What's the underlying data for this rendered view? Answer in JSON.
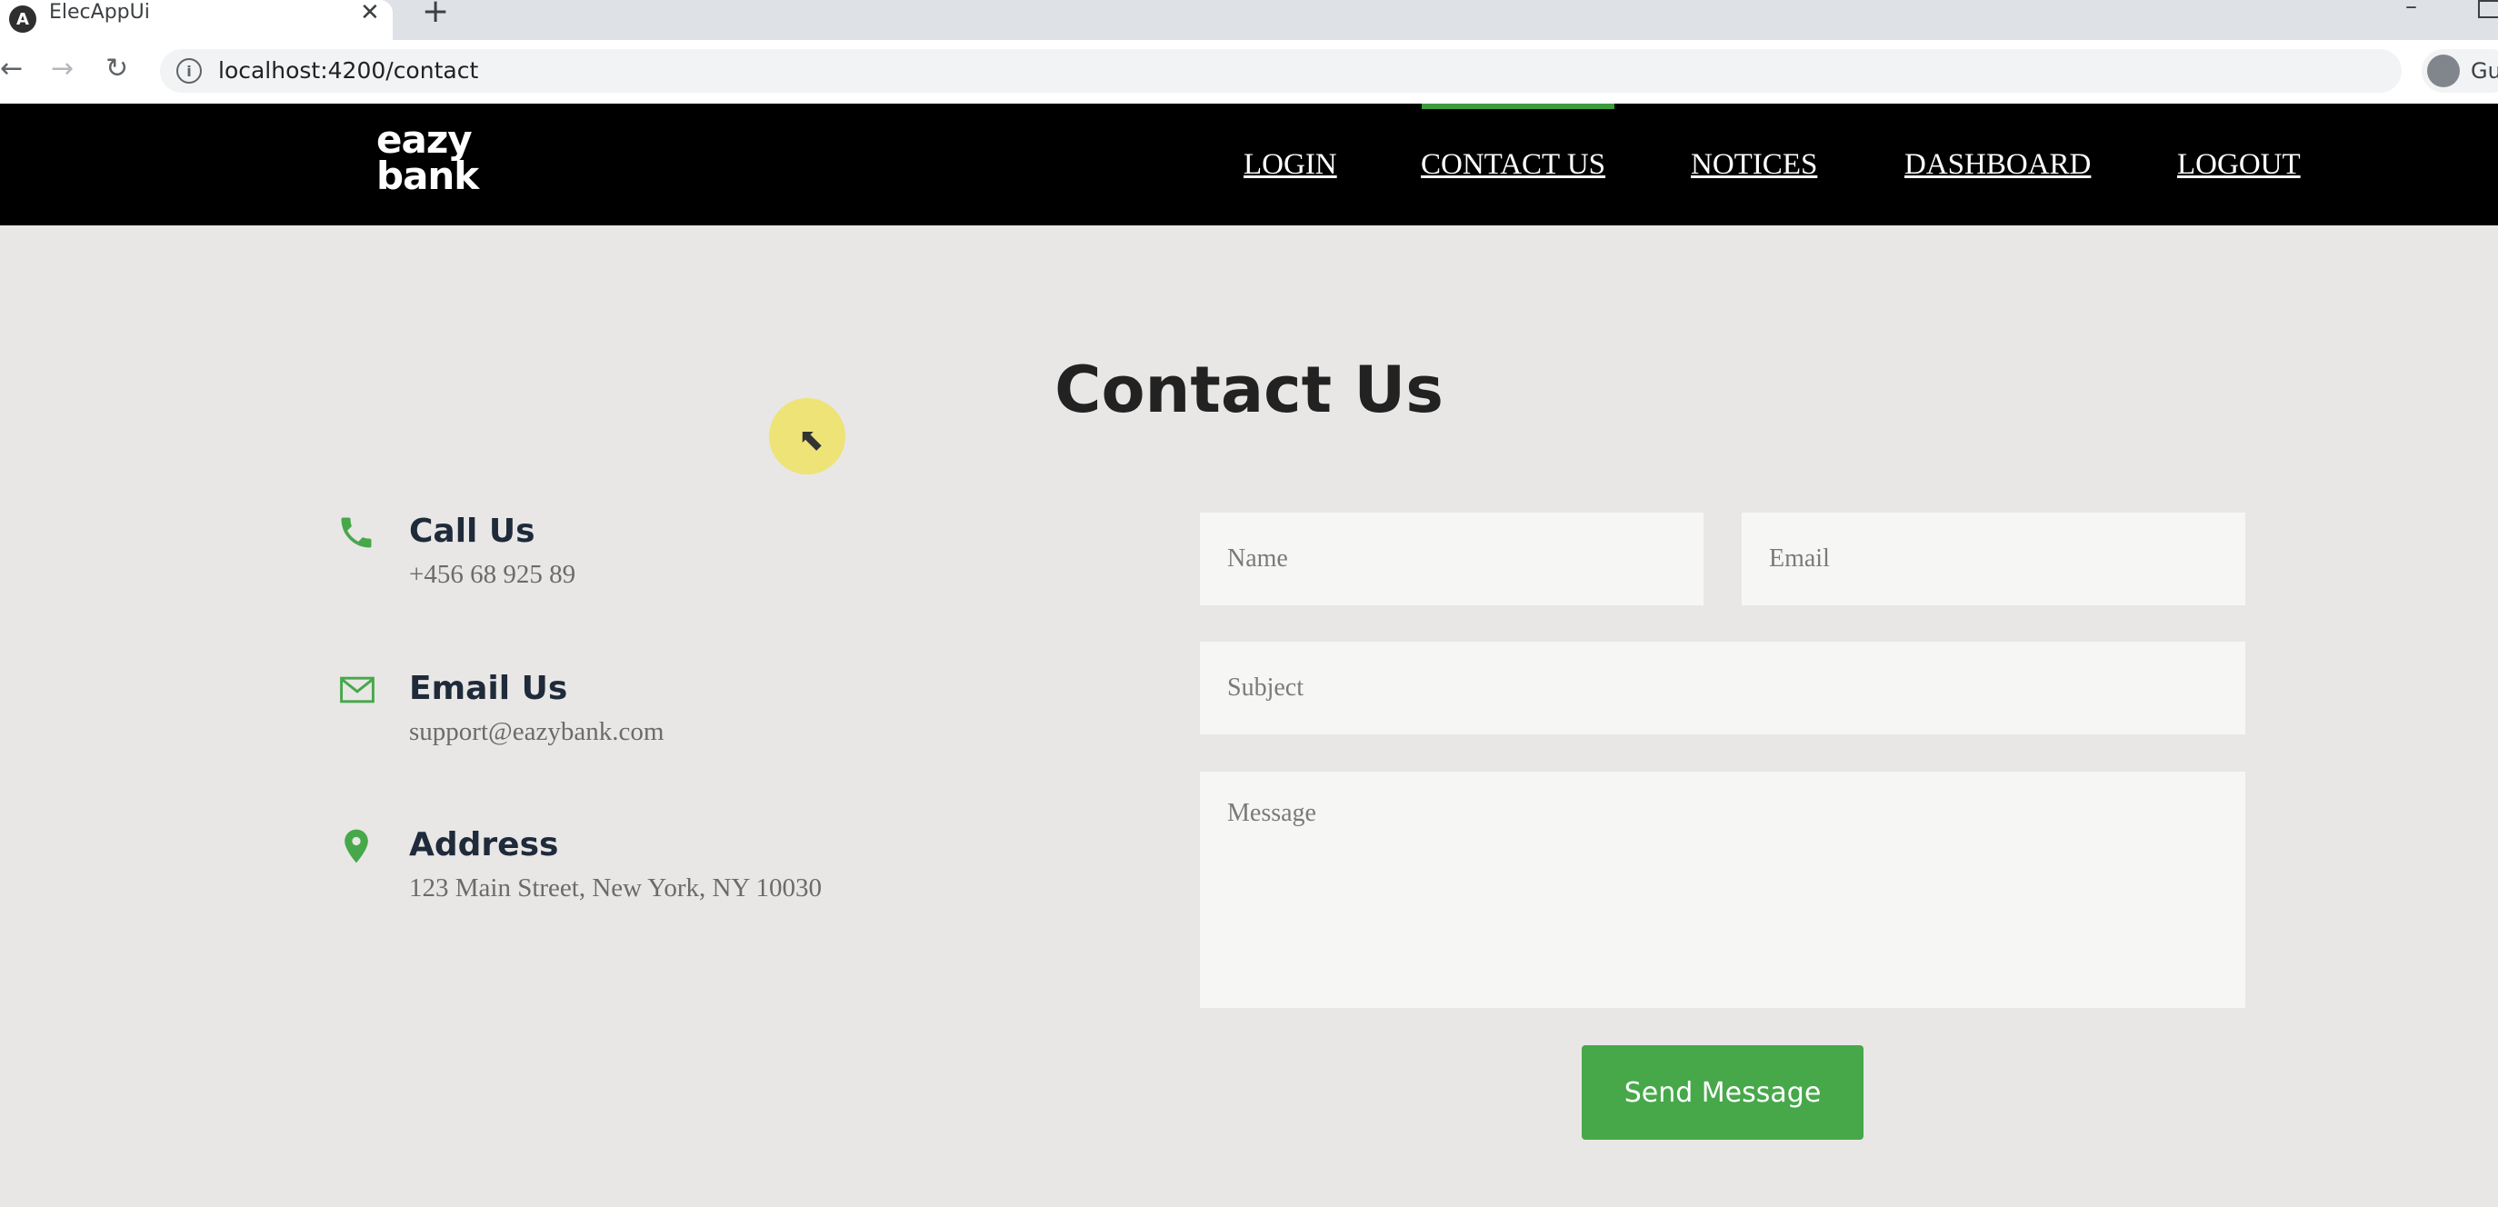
{
  "browser": {
    "tab_title": "ElecAppUi",
    "tab_favicon": "A",
    "tab_close": "✕",
    "new_tab": "+",
    "url": "localhost:4200/contact",
    "profile_name": "Gu",
    "icons": [
      "angular-favicon-icon",
      "back-icon",
      "forward-icon",
      "reload-icon",
      "info-icon",
      "profile-icon"
    ]
  },
  "site": {
    "logo": "eazy\nbank",
    "logo_line1": "eazy",
    "logo_line2": "bank",
    "accent_color": "#47a84a",
    "nav": [
      {
        "label": "LOGIN"
      },
      {
        "label": "CONTACT US",
        "active": true
      },
      {
        "label": "NOTICES"
      },
      {
        "label": "DASHBOARD"
      },
      {
        "label": "LOGOUT"
      }
    ]
  },
  "contact": {
    "title": "Contact Us",
    "items": [
      {
        "icon": "phone-icon",
        "heading": "Call Us",
        "value": "+456 68 925 89"
      },
      {
        "icon": "envelope-icon",
        "heading": "Email Us",
        "value": "support@eazybank.com"
      },
      {
        "icon": "map-pin-icon",
        "heading": "Address",
        "value": "123 Main Street, New York, NY 10030"
      }
    ],
    "form": {
      "name_placeholder": "Name",
      "email_placeholder": "Email",
      "subject_placeholder": "Subject",
      "message_placeholder": "Message",
      "submit_label": "Send Message"
    }
  }
}
